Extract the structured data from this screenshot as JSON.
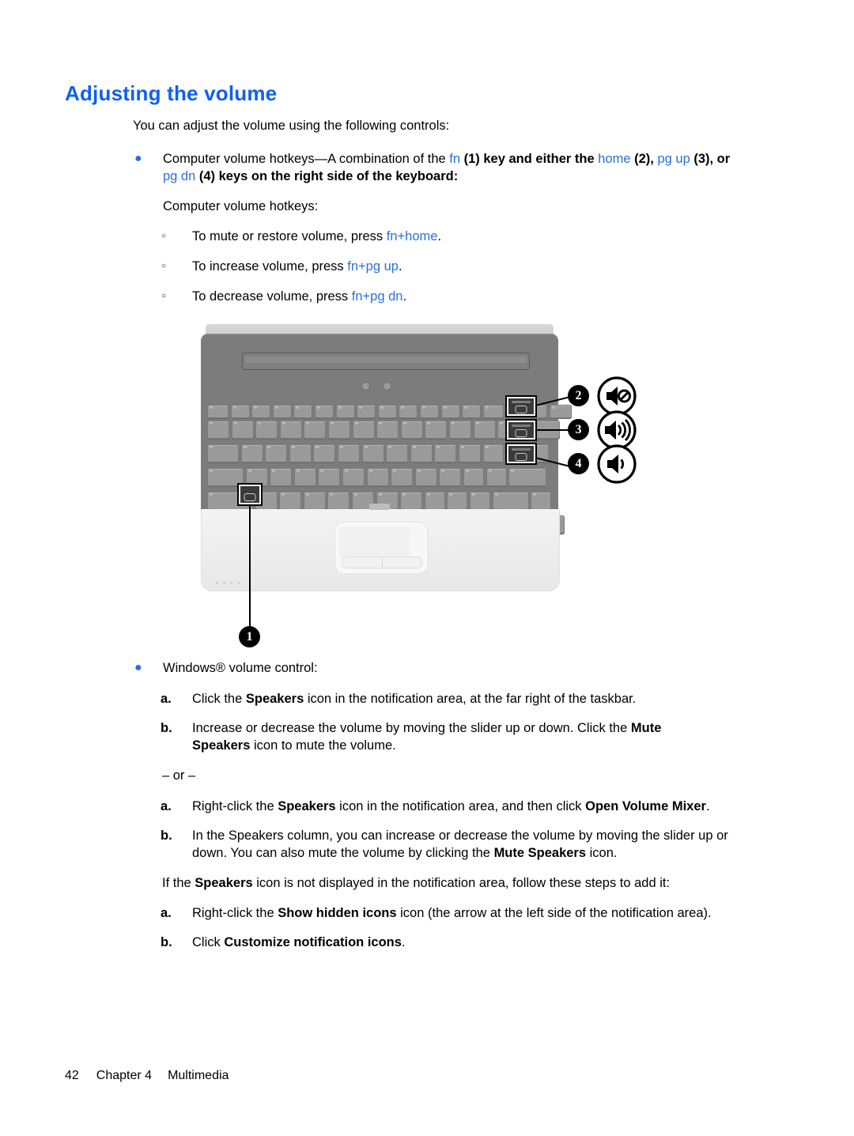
{
  "document": {
    "heading": "Adjusting the volume",
    "intro": "You can adjust the volume using the following controls:",
    "bullet1": {
      "seg1": "Computer volume hotkeys—A combination of the ",
      "key_fn": "fn",
      "seg2": " (1) key and either the ",
      "key_home": "home",
      "seg3": " (2), ",
      "key_pgup": "pg up",
      "seg4": " (3), or",
      "line2_key": "pg dn",
      "line2_rest": " (4) keys on the right side of the keyboard:"
    },
    "hotkeys_label": "Computer volume hotkeys:",
    "subbullets": [
      {
        "text": "To mute or restore volume, press ",
        "key": "fn+home",
        "tail": "."
      },
      {
        "text": "To increase volume, press ",
        "key": "fn+pg up",
        "tail": "."
      },
      {
        "text": "To decrease volume, press ",
        "key": "fn+pg dn",
        "tail": "."
      }
    ],
    "bullet2": "Windows® volume control:",
    "steps_group1": [
      {
        "marker": "a.",
        "parts": [
          "Click the ",
          "Speakers",
          " icon in the notification area, at the far right of the taskbar."
        ]
      },
      {
        "marker": "b.",
        "line1": [
          "Increase or decrease the volume by moving the slider up or down. Click the ",
          "Mute"
        ],
        "line2": [
          "Speakers",
          " icon to mute the volume."
        ]
      }
    ],
    "or_divider": "– or –",
    "steps_group2": [
      {
        "marker": "a.",
        "parts": [
          "Right-click the ",
          "Speakers",
          " icon in the notification area, and then click ",
          "Open Volume Mixer",
          "."
        ]
      },
      {
        "marker": "b.",
        "line1": [
          "In the Speakers column, you can increase or decrease the volume by moving the slider up or"
        ],
        "line2": [
          "down. You can also mute the volume by clicking the ",
          "Mute Speakers",
          " icon."
        ]
      }
    ],
    "note": [
      "If the ",
      "Speakers",
      " icon is not displayed in the notification area, follow these steps to add it:"
    ],
    "steps_group3": [
      {
        "marker": "a.",
        "parts": [
          "Right-click the ",
          "Show hidden icons",
          " icon (the arrow at the left side of the notification area)."
        ]
      },
      {
        "marker": "b.",
        "parts": [
          "Click ",
          "Customize notification icons",
          "."
        ]
      }
    ]
  },
  "figure": {
    "alt": "HP notebook keyboard showing volume hotkeys",
    "callouts": [
      {
        "number": "1",
        "target": "fn-key"
      },
      {
        "number": "2",
        "target": "home-key",
        "icon": "speaker-mute-icon"
      },
      {
        "number": "3",
        "target": "pg-up-key",
        "icon": "speaker-volume-up-icon"
      },
      {
        "number": "4",
        "target": "pg-dn-key",
        "icon": "speaker-volume-down-icon"
      }
    ]
  },
  "footer": {
    "page_number": "42",
    "chapter": "Chapter 4",
    "section": "Multimedia"
  },
  "colors": {
    "heading_blue": "#1060ee",
    "link_blue": "#2a6fe0",
    "text_black": "#000000"
  }
}
